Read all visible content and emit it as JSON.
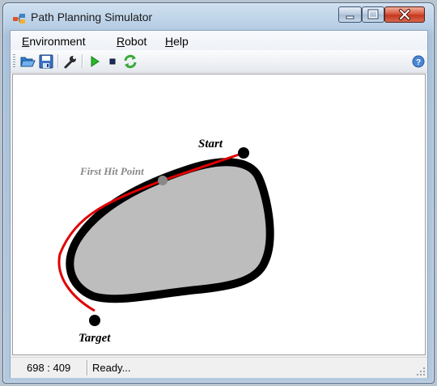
{
  "window": {
    "title": "Path Planning Simulator"
  },
  "menu": {
    "items": [
      "Environment",
      "Robot",
      "Help"
    ],
    "mnemonics": [
      "E",
      "R",
      "H"
    ]
  },
  "toolbar": {
    "buttons": [
      "open-icon",
      "save-icon",
      "settings-wrench-icon",
      "play-icon",
      "stop-icon",
      "refresh-icon",
      "help-icon"
    ]
  },
  "canvas": {
    "labels": {
      "start": "Start",
      "first_hit": "First Hit Point",
      "target": "Target"
    },
    "colors": {
      "path": "#e00000",
      "obstacle_fill": "#bdbdbd",
      "obstacle_border": "#000000",
      "hit_point": "#888888"
    }
  },
  "status": {
    "coords": "698 : 409",
    "text": "Ready..."
  }
}
